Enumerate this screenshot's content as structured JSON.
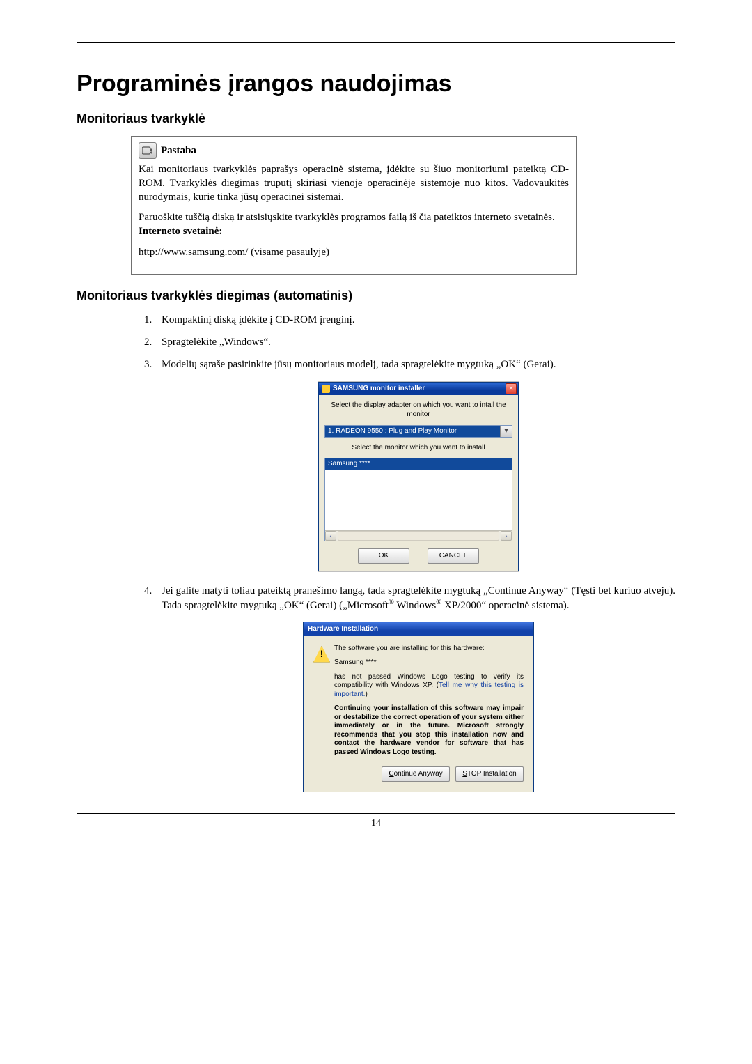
{
  "doc": {
    "title": "Programinės įrangos naudojimas",
    "section1": "Monitoriaus tvarkyklė",
    "section2": "Monitoriaus tvarkyklės diegimas (automatinis)",
    "page_number": "14"
  },
  "note": {
    "label": "Pastaba",
    "para1": "Kai monitoriaus tvarkyklės paprašys operacinė sistema, įdėkite su šiuo monitoriumi pateiktą CD-ROM. Tvarkyklės diegimas truputį skiriasi vienoje operacinėje sistemoje nuo kitos. Vadovaukitės nurodymais, kurie tinka jūsų operacinei sistemai.",
    "para2": "Paruoškite tuščią diską ir atsisiųskite tvarkyklės programos failą iš čia pateiktos interneto svetainės.",
    "site_label": "Interneto svetainė:",
    "site_url": "http://www.samsung.com/ (visame pasaulyje)"
  },
  "steps": {
    "s1": "Kompaktinį diską įdėkite į CD-ROM įrenginį.",
    "s2": "Spragtelėkite „Windows“.",
    "s3": "Modelių sąraše pasirinkite jūsų monitoriaus modelį, tada spragtelėkite mygtuką „OK“ (Gerai).",
    "s4_pre": "Jei galite matyti toliau pateiktą pranešimo langą, tada spragtelėkite mygtuką „Continue Anyway“ (Tęsti bet kuriuo atveju). Tada spragtelėkite mygtuką „OK“ (Gerai) („Microsoft",
    "s4_mid": " Windows",
    "s4_post": " XP/2000“ operacinė sistema)."
  },
  "installer": {
    "title": "SAMSUNG monitor installer",
    "line1": "Select the display adapter on which you want to intall the monitor",
    "adapter": "1. RADEON 9550 : Plug and Play Monitor",
    "line2": "Select the monitor which you want to install",
    "list_sel": "Samsung ****",
    "ok": "OK",
    "cancel": "CANCEL"
  },
  "hw": {
    "title": "Hardware Installation",
    "warn_glyph": "!",
    "p1": "The software you are installing for this hardware:",
    "p2": "Samsung ****",
    "p3a": "has not passed Windows Logo testing to verify its compatibility with Windows XP. (",
    "p3link": "Tell me why this testing is important.",
    "p3b": ")",
    "b1": "Continuing your installation of this software may impair or destabilize the correct operation of your system either immediately or in the future. Microsoft strongly recommends that you stop this installation now and contact the hardware vendor for software that has passed Windows Logo testing.",
    "btn_continue": "Continue Anyway",
    "btn_stop": "STOP Installation",
    "underline_c": "C",
    "underline_s": "S"
  }
}
